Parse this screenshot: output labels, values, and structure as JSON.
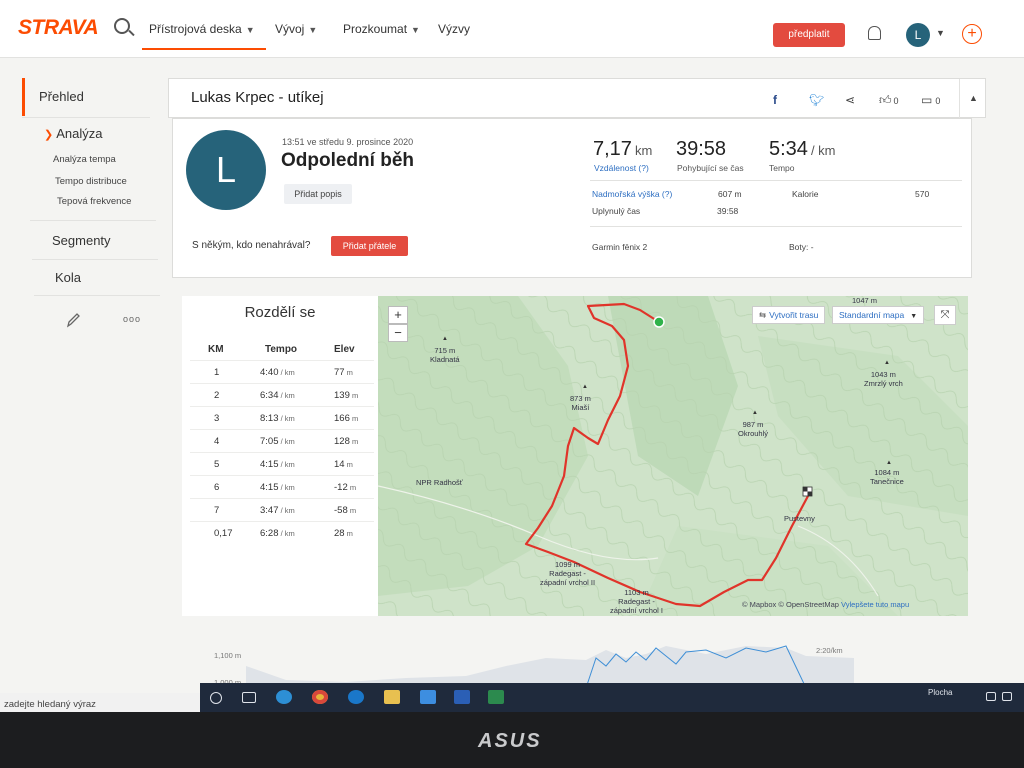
{
  "header": {
    "brand": "STRAVA",
    "nav": [
      "Přístrojová deska",
      "Vývoj",
      "Prozkoumat",
      "Výzvy"
    ],
    "subscribe_label": "předplatit",
    "avatar_letter": "L",
    "accent": "#fc4c02"
  },
  "sidebar": {
    "overview": "Přehled",
    "analysis": "Analýza",
    "sub_items": [
      "Analýza tempa",
      "Tempo distribuce",
      "Tepová frekvence"
    ],
    "segments": "Segmenty",
    "laps": "Kola",
    "more": "ooo"
  },
  "activity": {
    "athlete_title": "Lukas Krpec - utíkej",
    "likes": "0",
    "comments": "0",
    "avatar_letter": "L",
    "datetime": "13:51 ve středu 9. prosince 2020",
    "name": "Odpolední běh",
    "add_description": "Přidat popis",
    "invite_text": "S někým, kdo nenahrával?",
    "invite_button": "Přidat přátele",
    "stats": {
      "distance_value": "7,17",
      "distance_unit": "km",
      "distance_label": "Vzdálenost (?)",
      "moving_time_value": "39:58",
      "moving_time_label": "Pohybující se čas",
      "pace_value": "5:34",
      "pace_unit": "/ km",
      "pace_label": "Tempo"
    },
    "details": {
      "elevation_label": "Nadmořská výška (?)",
      "elevation_value": "607 m",
      "calories_label": "Kalorie",
      "calories_value": "570",
      "elapsed_label": "Uplynulý čas",
      "elapsed_value": "39:58",
      "device": "Garmin fēnix 2",
      "shoes": "Boty: -"
    }
  },
  "splits": {
    "title": "Rozdělí se",
    "headers": [
      "KM",
      "Tempo",
      "Elev"
    ],
    "rows": [
      {
        "km": "1",
        "pace": "4:40",
        "elev": "77"
      },
      {
        "km": "2",
        "pace": "6:34",
        "elev": "139"
      },
      {
        "km": "3",
        "pace": "8:13",
        "elev": "166"
      },
      {
        "km": "4",
        "pace": "7:05",
        "elev": "128"
      },
      {
        "km": "5",
        "pace": "4:15",
        "elev": "14"
      },
      {
        "km": "6",
        "pace": "4:15",
        "elev": "-12"
      },
      {
        "km": "7",
        "pace": "3:47",
        "elev": "-58"
      },
      {
        "km": "0,17",
        "pace": "6:28",
        "elev": "28"
      }
    ],
    "pace_unit": "/ km",
    "elev_unit": "m"
  },
  "map": {
    "create_route": "Vytvořit trasu",
    "map_style": "Standardní mapa",
    "attribution_a": "© Mapbox © OpenStreetMap",
    "attribution_b": "Vylepšete tuto mapu",
    "labels": {
      "kladnata": "715 m\nKladnatá",
      "miasi": "873 m\nMiaší",
      "okrouhly": "987 m\nOkrouhlý",
      "zmrzly": "1043 m\nZmrzlý vrch",
      "tanecnice": "1084 m\nTanečnice",
      "npr": "NPR Radhošť",
      "pustevny": "Pustevny",
      "radegast2": "1099 m\nRadegast -\nzápadní vrchol II",
      "radegast1": "1103 m\nRadegast -\nzápadní vrchol I",
      "top": "1047 m"
    },
    "route_color": "#e0342a"
  },
  "elevation": {
    "label_a": "1,100 m",
    "label_b": "1,000 m",
    "label_c": "2:20/km"
  },
  "taskbar": {
    "search_placeholder": "zadejte hledaný výraz",
    "desktop": "Plocha"
  },
  "bezel": {
    "logo": "ASUS"
  }
}
